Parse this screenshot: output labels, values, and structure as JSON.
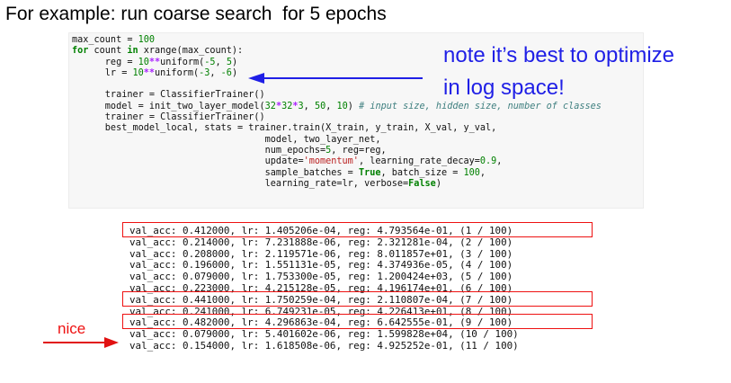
{
  "slide": {
    "title": "For example: run coarse search  for 5 epochs",
    "note_line1": "note it’s best to optimize",
    "note_line2": "in log space!",
    "nice_label": "nice"
  },
  "code": {
    "l1_a": "max_count = ",
    "l1_num": "100",
    "l2_kw1": "for",
    "l2_a": " count ",
    "l2_kw2": "in",
    "l2_b": " xrange(max_count):",
    "l3_a": "      reg = ",
    "l3_num": "10",
    "l3_op": "**",
    "l3_b": "uniform(",
    "l3_c": "-5",
    "l3_d": ", ",
    "l3_e": "5",
    "l3_f": ")",
    "l4_a": "      lr = ",
    "l4_num": "10",
    "l4_op": "**",
    "l4_b": "uniform(",
    "l4_c": "-3",
    "l4_d": ", ",
    "l4_e": "-6",
    "l4_f": ")",
    "l6": "      trainer = ClassifierTrainer()",
    "l7_a": "      model = init_two_layer_model(",
    "l7_n1": "32",
    "l7_op1": "*",
    "l7_n2": "32",
    "l7_op2": "*",
    "l7_n3": "3",
    "l7_b": ", ",
    "l7_n4": "50",
    "l7_c": ", ",
    "l7_n5": "10",
    "l7_d": ") ",
    "l7_cmt": "# input size, hidden size, number of classes",
    "l8": "      trainer = ClassifierTrainer()",
    "l9": "      best_model_local, stats = trainer.train(X_train, y_train, X_val, y_val,",
    "l10": "                                   model, two_layer_net,",
    "l11_a": "                                   num_epochs=",
    "l11_num": "5",
    "l11_b": ", reg=reg,",
    "l12_a": "                                   update=",
    "l12_str": "'momentum'",
    "l12_b": ", learning_rate_decay=",
    "l12_num": "0.9",
    "l12_c": ",",
    "l13_a": "                                   sample_batches = ",
    "l13_kw": "True",
    "l13_b": ", batch_size = ",
    "l13_num": "100",
    "l13_c": ",",
    "l14_a": "                                   learning_rate=lr, verbose=",
    "l14_kw": "False",
    "l14_b": ")"
  },
  "results": [
    "val_acc: 0.412000, lr: 1.405206e-04, reg: 4.793564e-01, (1 / 100)",
    "val_acc: 0.214000, lr: 7.231888e-06, reg: 2.321281e-04, (2 / 100)",
    "val_acc: 0.208000, lr: 2.119571e-06, reg: 8.011857e+01, (3 / 100)",
    "val_acc: 0.196000, lr: 1.551131e-05, reg: 4.374936e-05, (4 / 100)",
    "val_acc: 0.079000, lr: 1.753300e-05, reg: 1.200424e+03, (5 / 100)",
    "val_acc: 0.223000, lr: 4.215128e-05, reg: 4.196174e+01, (6 / 100)",
    "val_acc: 0.441000, lr: 1.750259e-04, reg: 2.110807e-04, (7 / 100)",
    "val_acc: 0.241000, lr: 6.749231e-05, reg: 4.226413e+01, (8 / 100)",
    "val_acc: 0.482000, lr: 4.296863e-04, reg: 6.642555e-01, (9 / 100)",
    "val_acc: 0.079000, lr: 5.401602e-06, reg: 1.599828e+04, (10 / 100)",
    "val_acc: 0.154000, lr: 1.618508e-06, reg: 4.925252e-01, (11 / 100)"
  ],
  "colors": {
    "annotation": "#e11111",
    "note": "#1f1fe6",
    "keyword": "#008000",
    "string": "#ba2121"
  }
}
